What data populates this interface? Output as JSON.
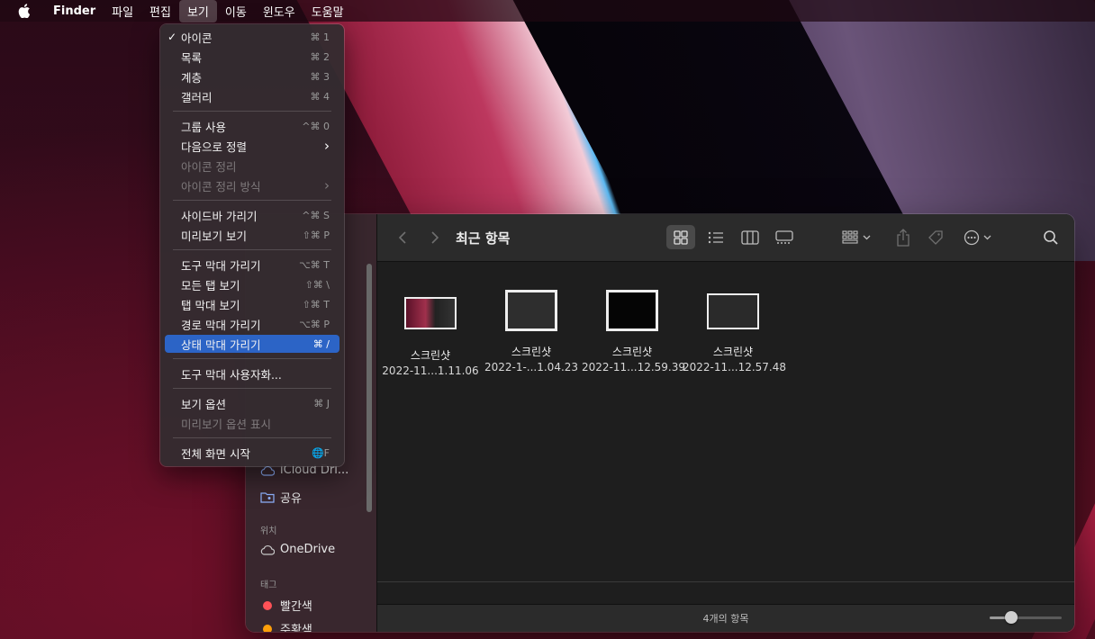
{
  "menubar": {
    "app_name": "Finder",
    "items": [
      "파일",
      "편집",
      "보기",
      "이동",
      "윈도우",
      "도움말"
    ],
    "active_item": "보기"
  },
  "view_menu": {
    "items": [
      {
        "label": "아이콘",
        "shortcut": "⌘ 1",
        "checked": true
      },
      {
        "label": "목록",
        "shortcut": "⌘ 2"
      },
      {
        "label": "계층",
        "shortcut": "⌘ 3"
      },
      {
        "label": "갤러리",
        "shortcut": "⌘ 4"
      },
      {
        "label": "그룹 사용",
        "shortcut": "^⌘ 0"
      },
      {
        "label": "다음으로 정렬",
        "shortcut": "›"
      },
      {
        "label": "아이콘 정리",
        "shortcut": "",
        "disabled": true
      },
      {
        "label": "아이콘 정리 방식",
        "shortcut": "›",
        "disabled": true
      },
      {
        "label": "사이드바 가리기",
        "shortcut": "^⌘ S"
      },
      {
        "label": "미리보기 보기",
        "shortcut": "⇧⌘ P"
      },
      {
        "label": "도구 막대 가리기",
        "shortcut": "⌥⌘ T"
      },
      {
        "label": "모든 탭 보기",
        "shortcut": "⇧⌘ \\"
      },
      {
        "label": "탭 막대 보기",
        "shortcut": "⇧⌘ T"
      },
      {
        "label": "경로 막대 가리기",
        "shortcut": "⌥⌘ P"
      },
      {
        "label": "상태 막대 가리기",
        "shortcut": "⌘ /",
        "highlighted": true
      },
      {
        "label": "도구 막대 사용자화...",
        "shortcut": ""
      },
      {
        "label": "보기 옵션",
        "shortcut": "⌘ J"
      },
      {
        "label": "미리보기 옵션 표시",
        "shortcut": "",
        "disabled": true
      },
      {
        "label": "전체 화면 시작",
        "shortcut": "🌐F"
      }
    ]
  },
  "sidebar": {
    "items": [
      {
        "label": "iCloud Dri...",
        "icon": "cloud-icon"
      },
      {
        "label": "공유",
        "icon": "shared-folder-icon"
      }
    ],
    "locations_header": "위치",
    "locations": [
      {
        "label": "OneDrive",
        "icon": "cloud-icon"
      }
    ],
    "tags_header": "태그",
    "tags": [
      {
        "label": "빨간색",
        "color": "#ff5257"
      },
      {
        "label": "주황색",
        "color": "#ff9f0a"
      }
    ]
  },
  "toolbar": {
    "title": "최근 항목",
    "icons": [
      "back-chevron-icon",
      "forward-chevron-icon",
      "icon-view-icon",
      "list-view-icon",
      "column-view-icon",
      "gallery-view-icon",
      "group-icon",
      "share-icon",
      "tag-icon",
      "more-actions-icon",
      "search-icon"
    ]
  },
  "files": [
    {
      "name": "스크린샷",
      "date": "2022-11...1.11.06"
    },
    {
      "name": "스크린샷",
      "date": "2022-1-...1.04.23"
    },
    {
      "name": "스크린샷",
      "date": "2022-11...12.59.39"
    },
    {
      "name": "스크린샷",
      "date": "2022-11...12.57.48"
    }
  ],
  "status": {
    "item_count": "4개의 항목",
    "icon_size_level": 0.3
  },
  "colors": {
    "menu_highlight": "#2c64c6",
    "window_bg": "#1e1e1e"
  }
}
